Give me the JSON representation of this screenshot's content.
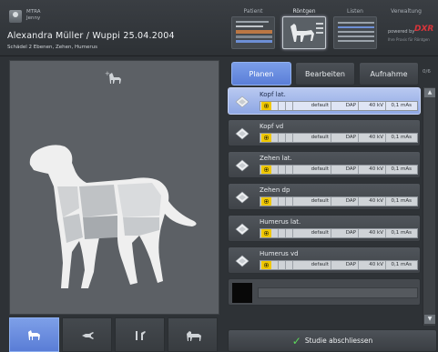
{
  "header": {
    "user_role": "MTRA",
    "user_name": "Jenny",
    "patient_title": "Alexandra Müller / Wuppi  25.04.2004",
    "study_desc": "Schädel 2 Ebenen, Zehen, Humerus",
    "nav": [
      {
        "label": "Patient"
      },
      {
        "label": "Röntgen"
      },
      {
        "label": "Listen"
      },
      {
        "label": "Verwaltung"
      }
    ],
    "brand": "powered by",
    "brand_mark": "DXR",
    "brand_sub": "Ihre Praxis für Röntgen"
  },
  "tabs": [
    {
      "label": "Planen"
    },
    {
      "label": "Bearbeiten"
    },
    {
      "label": "Aufnahme"
    }
  ],
  "page_indicator": "0/6",
  "exposures": [
    {
      "name": "Kopf lat.",
      "preset": "default",
      "dap": "DAP",
      "kv": "40 kV",
      "mas": "0,1 mAs",
      "selected": true
    },
    {
      "name": "Kopf vd",
      "preset": "default",
      "dap": "DAP",
      "kv": "40 kV",
      "mas": "0,1 mAs",
      "selected": false
    },
    {
      "name": "Zehen lat.",
      "preset": "default",
      "dap": "DAP",
      "kv": "40 kV",
      "mas": "0,1 mAs",
      "selected": false
    },
    {
      "name": "Zehen dp",
      "preset": "default",
      "dap": "DAP",
      "kv": "40 kV",
      "mas": "0,1 mAs",
      "selected": false
    },
    {
      "name": "Humerus lat.",
      "preset": "default",
      "dap": "DAP",
      "kv": "40 kV",
      "mas": "0,1 mAs",
      "selected": false
    },
    {
      "name": "Humerus vd",
      "preset": "default",
      "dap": "DAP",
      "kv": "40 kV",
      "mas": "0,1 mAs",
      "selected": false
    }
  ],
  "finish_label": "Studie abschliessen",
  "colors": {
    "accent": "#6a8ee0",
    "selected_row": "#a9bdee",
    "radiation": "#f0c800"
  }
}
